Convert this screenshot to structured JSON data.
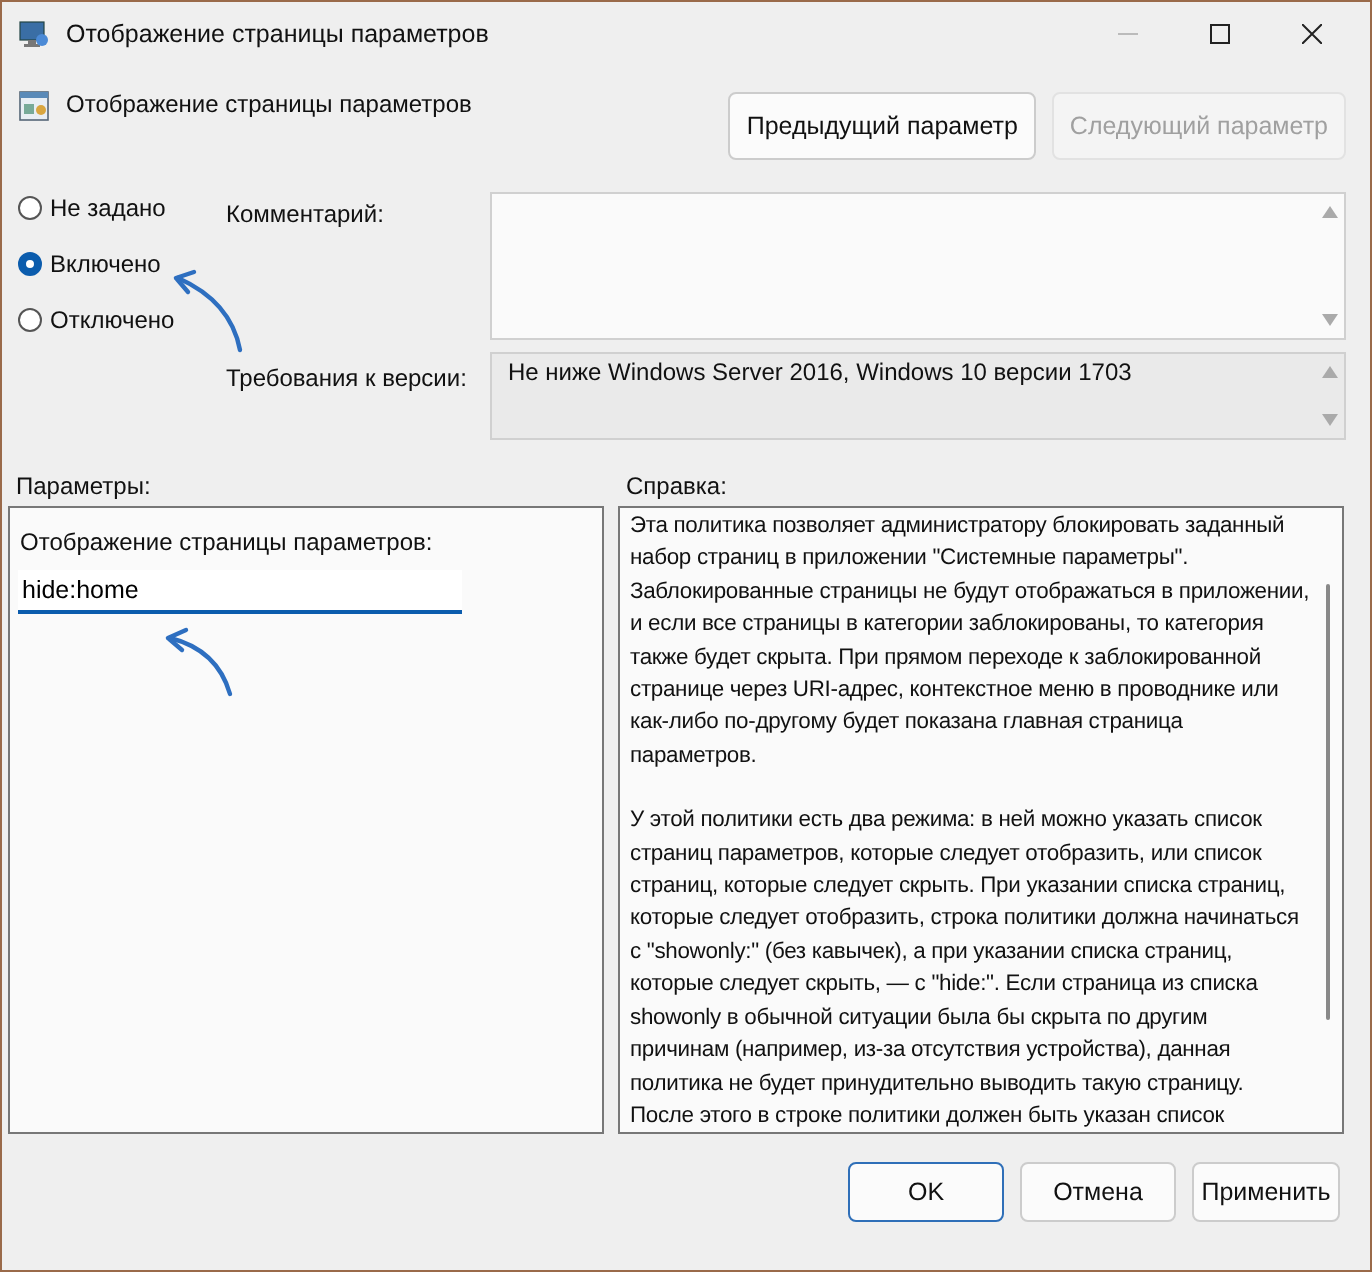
{
  "window": {
    "title": "Отображение страницы параметров"
  },
  "header": {
    "title": "Отображение страницы параметров",
    "buttons": [
      {
        "label": "Предыдущий параметр",
        "disabled": false
      },
      {
        "label": "Следующий параметр",
        "disabled": true
      }
    ]
  },
  "state_options": [
    {
      "label": "Не задано",
      "selected": false
    },
    {
      "label": "Включено",
      "selected": true
    },
    {
      "label": "Отключено",
      "selected": false
    }
  ],
  "comment": {
    "label": "Комментарий:"
  },
  "requirements": {
    "label": "Требования к версии:",
    "value": "Не ниже Windows Server 2016, Windows 10 версии 1703"
  },
  "options": {
    "label": "Параметры:",
    "field_label": "Отображение страницы параметров:",
    "value": "hide:home"
  },
  "help": {
    "label": "Справка:",
    "paragraphs": [
      "Эта политика позволяет администратору блокировать заданный набор страниц в приложении \"Системные параметры\". Заблокированные страницы не будут отображаться в приложении, и если все страницы в категории заблокированы, то категория также будет скрыта. При прямом переходе к заблокированной странице через URI-адрес, контекстное меню в проводнике или как-либо по-другому будет показана главная страница параметров.",
      "У этой политики есть два режима: в ней можно указать список страниц параметров, которые следует отобразить, или список страниц, которые следует скрыть. При указании списка страниц, которые следует отобразить, строка политики должна начинаться с \"showonly:\" (без кавычек), а при указании списка страниц, которые следует скрыть, — с \"hide:\". Если страница из списка showonly в обычной ситуации была бы скрыта по другим причинам (например, из-за отсутствия устройства), данная политика не будет принудительно выводить такую страницу. После этого в строке политики должен быть указан список"
    ]
  },
  "footer_buttons": [
    {
      "label": "OK",
      "default": true
    },
    {
      "label": "Отмена",
      "default": false
    },
    {
      "label": "Применить",
      "default": false
    }
  ]
}
